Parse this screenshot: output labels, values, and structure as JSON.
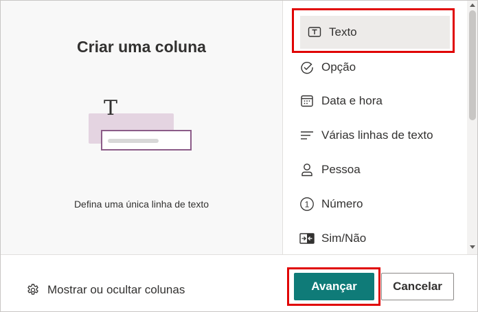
{
  "preview": {
    "title": "Criar uma coluna",
    "illustration_glyph": "T",
    "description": "Defina uma única linha de texto"
  },
  "column_types": [
    {
      "label": "Texto",
      "icon": "text-box-icon",
      "selected": true
    },
    {
      "label": "Opção",
      "icon": "check-circle-icon",
      "selected": false
    },
    {
      "label": "Data e hora",
      "icon": "calendar-icon",
      "selected": false
    },
    {
      "label": "Várias linhas de texto",
      "icon": "multiline-text-icon",
      "selected": false
    },
    {
      "label": "Pessoa",
      "icon": "person-icon",
      "selected": false
    },
    {
      "label": "Número",
      "icon": "number-circle-icon",
      "selected": false
    },
    {
      "label": "Sim/Não",
      "icon": "yes-no-toggle-icon",
      "selected": false
    }
  ],
  "icon_glyphs": {
    "number": "1"
  },
  "footer": {
    "show_hide_label": "Mostrar ou ocultar colunas",
    "next_label": "Avançar",
    "cancel_label": "Cancelar"
  },
  "colors": {
    "accent": "#0f7b78",
    "highlight_box": "#e00000",
    "selected_bg": "#edebe9",
    "illustration_accent": "#8b5b88"
  }
}
